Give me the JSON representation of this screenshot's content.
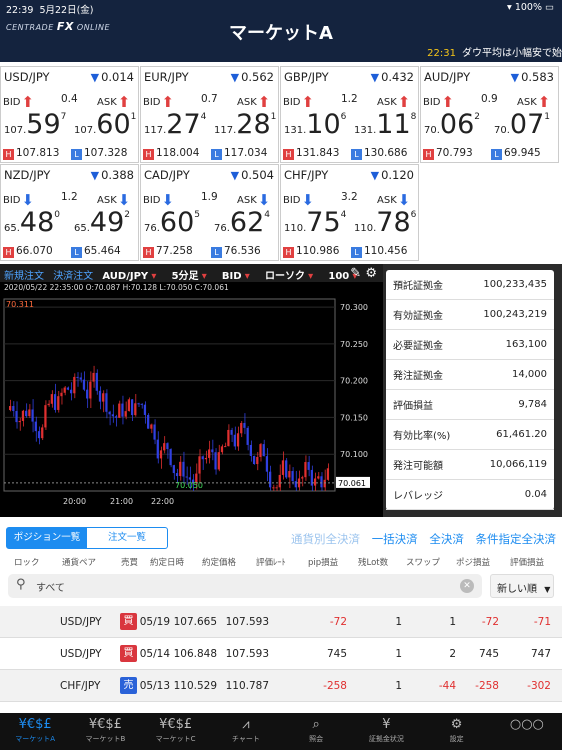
{
  "status": {
    "time": "22:39",
    "date": "5月22日(金)",
    "battery": "100%"
  },
  "header": {
    "logo_main": "CENTRADE",
    "logo_fx": "FX",
    "logo_sub": "ONLINE",
    "title": "マーケットA",
    "news_time": "22:31",
    "news_text": "ダウ平均は小幅安で始"
  },
  "tiles": [
    {
      "pair": "USD/JPY",
      "change": "0.014",
      "change_dir": "down",
      "bid_dir": "up",
      "ask_dir": "up",
      "spread": "0.4",
      "bid_pfx": "107.",
      "bid_big": "59",
      "bid_sup": "7",
      "ask_pfx": "107.",
      "ask_big": "60",
      "ask_sup": "1",
      "high": "107.813",
      "low": "107.328"
    },
    {
      "pair": "EUR/JPY",
      "change": "0.562",
      "change_dir": "down",
      "bid_dir": "up",
      "ask_dir": "up",
      "spread": "0.7",
      "bid_pfx": "117.",
      "bid_big": "27",
      "bid_sup": "4",
      "ask_pfx": "117.",
      "ask_big": "28",
      "ask_sup": "1",
      "high": "118.004",
      "low": "117.034"
    },
    {
      "pair": "GBP/JPY",
      "change": "0.432",
      "change_dir": "down",
      "bid_dir": "up",
      "ask_dir": "up",
      "spread": "1.2",
      "bid_pfx": "131.",
      "bid_big": "10",
      "bid_sup": "6",
      "ask_pfx": "131.",
      "ask_big": "11",
      "ask_sup": "8",
      "high": "131.843",
      "low": "130.686"
    },
    {
      "pair": "AUD/JPY",
      "change": "0.583",
      "change_dir": "down",
      "bid_dir": "up",
      "ask_dir": "up",
      "spread": "0.9",
      "bid_pfx": "70.",
      "bid_big": "06",
      "bid_sup": "2",
      "ask_pfx": "70.",
      "ask_big": "07",
      "ask_sup": "1",
      "high": "70.793",
      "low": "69.945"
    },
    {
      "pair": "NZD/JPY",
      "change": "0.388",
      "change_dir": "down",
      "bid_dir": "down",
      "ask_dir": "down",
      "spread": "1.2",
      "bid_pfx": "65.",
      "bid_big": "48",
      "bid_sup": "0",
      "ask_pfx": "65.",
      "ask_big": "49",
      "ask_sup": "2",
      "high": "66.070",
      "low": "65.464"
    },
    {
      "pair": "CAD/JPY",
      "change": "0.504",
      "change_dir": "down",
      "bid_dir": "down",
      "ask_dir": "down",
      "spread": "1.9",
      "bid_pfx": "76.",
      "bid_big": "60",
      "bid_sup": "5",
      "ask_pfx": "76.",
      "ask_big": "62",
      "ask_sup": "4",
      "high": "77.258",
      "low": "76.536"
    },
    {
      "pair": "CHF/JPY",
      "change": "0.120",
      "change_dir": "down",
      "bid_dir": "down",
      "ask_dir": "down",
      "spread": "3.2",
      "bid_pfx": "110.",
      "bid_big": "75",
      "bid_sup": "4",
      "ask_pfx": "110.",
      "ask_big": "78",
      "ask_sup": "6",
      "high": "110.986",
      "low": "110.456"
    }
  ],
  "labels": {
    "bid": "BID",
    "ask": "ASK",
    "h": "H",
    "l": "L"
  },
  "chart_bar": {
    "new_order": "新規注文",
    "settle_order": "決済注文",
    "pair": "AUD/JPY",
    "period": "5分足",
    "side": "BID",
    "kind": "ローソク",
    "count": "100"
  },
  "chart_info": "2020/05/22 22:35:00  O:70.087  H:70.128  L:70.050  C:70.061",
  "chart_data": {
    "type": "candlestick",
    "y_ticks": [
      "70.300",
      "70.250",
      "70.200",
      "70.150",
      "70.100"
    ],
    "x_ticks": [
      "20:00",
      "21:00",
      "22:00"
    ],
    "ylim": [
      70.05,
      70.311
    ],
    "max_label": "70.311",
    "min_label": "70.050",
    "last_label": "70.061"
  },
  "account": [
    {
      "label": "預託証拠金",
      "value": "100,233,435"
    },
    {
      "label": "有効証拠金",
      "value": "100,243,219"
    },
    {
      "label": "必要証拠金",
      "value": "163,100"
    },
    {
      "label": "発注証拠金",
      "value": "14,000"
    },
    {
      "label": "評価損益",
      "value": "9,784"
    },
    {
      "label": "有効比率(%)",
      "value": "61,461.20"
    },
    {
      "label": "発注可能額",
      "value": "10,066,119"
    },
    {
      "label": "レバレッジ",
      "value": "0.04"
    }
  ],
  "tabs": [
    "ポジション一覧",
    "注文一覧"
  ],
  "actions": [
    "通貨別全決済",
    "一括決済",
    "全決済",
    "条件指定全決済"
  ],
  "columns": [
    "ロック",
    "通貨ペア",
    "売買",
    "約定日時",
    "約定価格",
    "評価ﾚｰﾄ",
    "pip損益",
    "残Lot数",
    "スワップ",
    "ポジ損益",
    "評価損益"
  ],
  "search": {
    "value": "すべて",
    "sort": "新しい順"
  },
  "positions": [
    {
      "pair": "USD/JPY",
      "side": "買",
      "side_kind": "buy",
      "date": "05/19",
      "price": "107.665",
      "rate": "107.593",
      "pip": "-72",
      "lots": "1",
      "swap": "1",
      "pos_pl": "-72",
      "eval_pl": "-71"
    },
    {
      "pair": "USD/JPY",
      "side": "買",
      "side_kind": "buy",
      "date": "05/14",
      "price": "106.848",
      "rate": "107.593",
      "pip": "745",
      "lots": "1",
      "swap": "2",
      "pos_pl": "745",
      "eval_pl": "747"
    },
    {
      "pair": "CHF/JPY",
      "side": "売",
      "side_kind": "sell",
      "date": "05/13",
      "price": "110.529",
      "rate": "110.787",
      "pip": "-258",
      "lots": "1",
      "swap": "-44",
      "pos_pl": "-258",
      "eval_pl": "-302"
    }
  ],
  "nav": [
    {
      "icon": "currency-icon",
      "glyph": "¥€$£",
      "label": "マーケットA"
    },
    {
      "icon": "currency-icon",
      "glyph": "¥€$£",
      "label": "マーケットB"
    },
    {
      "icon": "currency-icon",
      "glyph": "¥€$£",
      "label": "マーケットC"
    },
    {
      "icon": "chart-icon",
      "glyph": "⩘",
      "label": "チャート"
    },
    {
      "icon": "search-icon",
      "glyph": "⌕",
      "label": "照会"
    },
    {
      "icon": "deposit-icon",
      "glyph": "¥",
      "label": "証拠金状況"
    },
    {
      "icon": "gear-icon",
      "glyph": "⚙",
      "label": "設定"
    },
    {
      "icon": "more-icon",
      "glyph": "○○○",
      "label": ""
    }
  ]
}
